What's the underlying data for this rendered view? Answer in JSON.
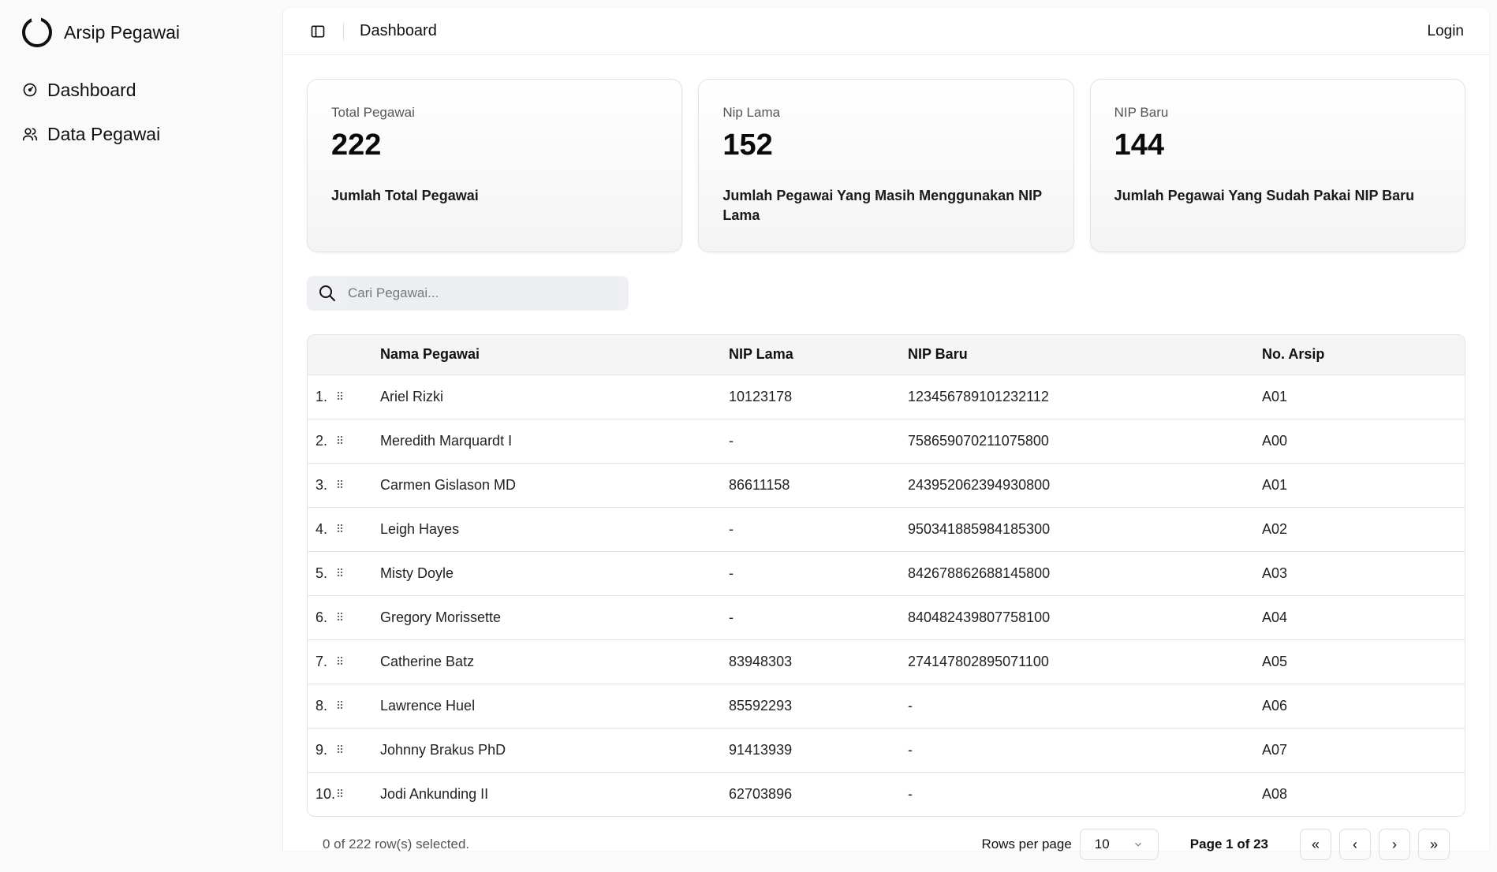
{
  "app": {
    "name": "Arsip Pegawai"
  },
  "sidebar": {
    "items": [
      {
        "label": "Dashboard",
        "icon": "gauge-icon"
      },
      {
        "label": "Data Pegawai",
        "icon": "users-icon"
      }
    ]
  },
  "header": {
    "breadcrumb": "Dashboard",
    "login_label": "Login"
  },
  "stats": [
    {
      "label": "Total Pegawai",
      "value": "222",
      "description": "Jumlah Total Pegawai"
    },
    {
      "label": "Nip Lama",
      "value": "152",
      "description": "Jumlah Pegawai Yang Masih Menggunakan NIP Lama"
    },
    {
      "label": "NIP Baru",
      "value": "144",
      "description": "Jumlah Pegawai Yang Sudah Pakai NIP Baru"
    }
  ],
  "search": {
    "placeholder": "Cari Pegawai...",
    "value": ""
  },
  "table": {
    "columns": [
      "Nama Pegawai",
      "NIP Lama",
      "NIP Baru",
      "No. Arsip"
    ],
    "rows": [
      {
        "no": "1.",
        "name": "Ariel Rizki",
        "nip_lama": "10123178",
        "nip_baru": "123456789101232112",
        "arsip": "A01"
      },
      {
        "no": "2.",
        "name": "Meredith Marquardt I",
        "nip_lama": "-",
        "nip_baru": "758659070211075800",
        "arsip": "A00"
      },
      {
        "no": "3.",
        "name": "Carmen Gislason MD",
        "nip_lama": "86611158",
        "nip_baru": "243952062394930800",
        "arsip": "A01"
      },
      {
        "no": "4.",
        "name": "Leigh Hayes",
        "nip_lama": "-",
        "nip_baru": "950341885984185300",
        "arsip": "A02"
      },
      {
        "no": "5.",
        "name": "Misty Doyle",
        "nip_lama": "-",
        "nip_baru": "842678862688145800",
        "arsip": "A03"
      },
      {
        "no": "6.",
        "name": "Gregory Morissette",
        "nip_lama": "-",
        "nip_baru": "840482439807758100",
        "arsip": "A04"
      },
      {
        "no": "7.",
        "name": "Catherine Batz",
        "nip_lama": "83948303",
        "nip_baru": "274147802895071100",
        "arsip": "A05"
      },
      {
        "no": "8.",
        "name": "Lawrence Huel",
        "nip_lama": "85592293",
        "nip_baru": "-",
        "arsip": "A06"
      },
      {
        "no": "9.",
        "name": "Johnny Brakus PhD",
        "nip_lama": "91413939",
        "nip_baru": "-",
        "arsip": "A07"
      },
      {
        "no": "10.",
        "name": "Jodi Ankunding II",
        "nip_lama": "62703896",
        "nip_baru": "-",
        "arsip": "A08"
      }
    ]
  },
  "footer": {
    "selected_text": "0 of 222 row(s) selected.",
    "rows_per_page_label": "Rows per page",
    "rows_per_page_value": "10",
    "page_info": "Page 1 of 23",
    "first_icon": "«",
    "prev_icon": "‹",
    "next_icon": "›",
    "last_icon": "»"
  }
}
